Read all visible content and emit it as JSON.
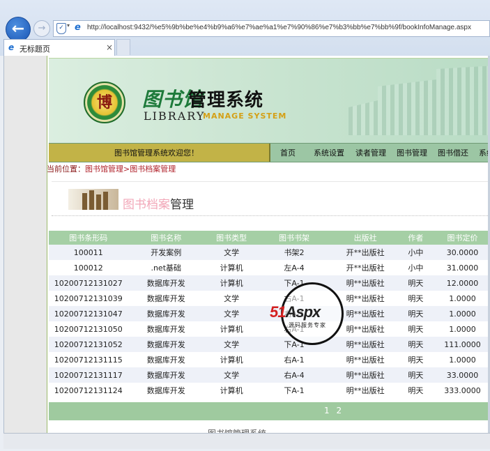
{
  "browser": {
    "url": "http://localhost:9432/%e5%9b%be%e4%b9%a6%e7%ae%a1%e7%90%86%e7%b3%bb%e7%bb%9f/bookInfoManage.aspx",
    "tab_title": "无标题页",
    "tab_close": "×",
    "back_glyph": "←",
    "forward_glyph": "→",
    "icons": [
      "back-arrow-icon",
      "forward-arrow-icon",
      "shield-icon",
      "ie-icon",
      "close-icon"
    ]
  },
  "banner": {
    "logo_seal": "博",
    "title_cn_art": "图书馆",
    "title_cn": "管理系统",
    "title_en": "LIBRARY",
    "title_en_sub": "MANAGE SYSTEM"
  },
  "nav": {
    "welcome": "图书馆管理系统欢迎您！",
    "items": [
      "首页",
      "系统设置",
      "读者管理",
      "图书管理",
      "图书借还",
      "系统"
    ]
  },
  "breadcrumb": {
    "prefix": "当前位置：",
    "path": "图书馆管理>图书档案管理"
  },
  "page_title": {
    "part1": "图书档案",
    "part2": "管理"
  },
  "table": {
    "headers": [
      "图书条形码",
      "图书名称",
      "图书类型",
      "图书书架",
      "出版社",
      "作者",
      "图书定价"
    ],
    "rows": [
      [
        "100011",
        "开发案例",
        "文学",
        "书架2",
        "开**出版社",
        "小中",
        "30.0000"
      ],
      [
        "100012",
        ".net基础",
        "计算机",
        "左A-4",
        "开**出版社",
        "小中",
        "31.0000"
      ],
      [
        "10200712131027",
        "数据库开发",
        "计算机",
        "下A-1",
        "明**出版社",
        "明天",
        "12.0000"
      ],
      [
        "10200712131039",
        "数据库开发",
        "文学",
        "右A-1",
        "明**出版社",
        "明天",
        "1.0000"
      ],
      [
        "10200712131047",
        "数据库开发",
        "文学",
        "右A-1",
        "明**出版社",
        "明天",
        "1.0000"
      ],
      [
        "10200712131050",
        "数据库开发",
        "计算机",
        "右A-1",
        "明**出版社",
        "明天",
        "1.0000"
      ],
      [
        "10200712131052",
        "数据库开发",
        "文学",
        "下A-1",
        "明**出版社",
        "明天",
        "111.0000"
      ],
      [
        "10200712131115",
        "数据库开发",
        "计算机",
        "右A-1",
        "明**出版社",
        "明天",
        "1.0000"
      ],
      [
        "10200712131117",
        "数据库开发",
        "文学",
        "右A-4",
        "明**出版社",
        "明天",
        "33.0000"
      ],
      [
        "10200712131124",
        "数据库开发",
        "计算机",
        "下A-1",
        "明**出版社",
        "明天",
        "333.0000"
      ]
    ]
  },
  "pager": {
    "text": "1 2"
  },
  "footer": {
    "text": "图书馆管理系统"
  },
  "watermark": {
    "brand_red": "51",
    "brand_dark": "Aspx",
    "tagline": "源码服务专家"
  },
  "colors": {
    "nav_bg": "#9cc6a4",
    "welcome_bg": "#c2b347",
    "header_bg": "#a5cfa5",
    "row_alt": "#eef1f8",
    "breadcrumb": "#8b1a1a"
  }
}
